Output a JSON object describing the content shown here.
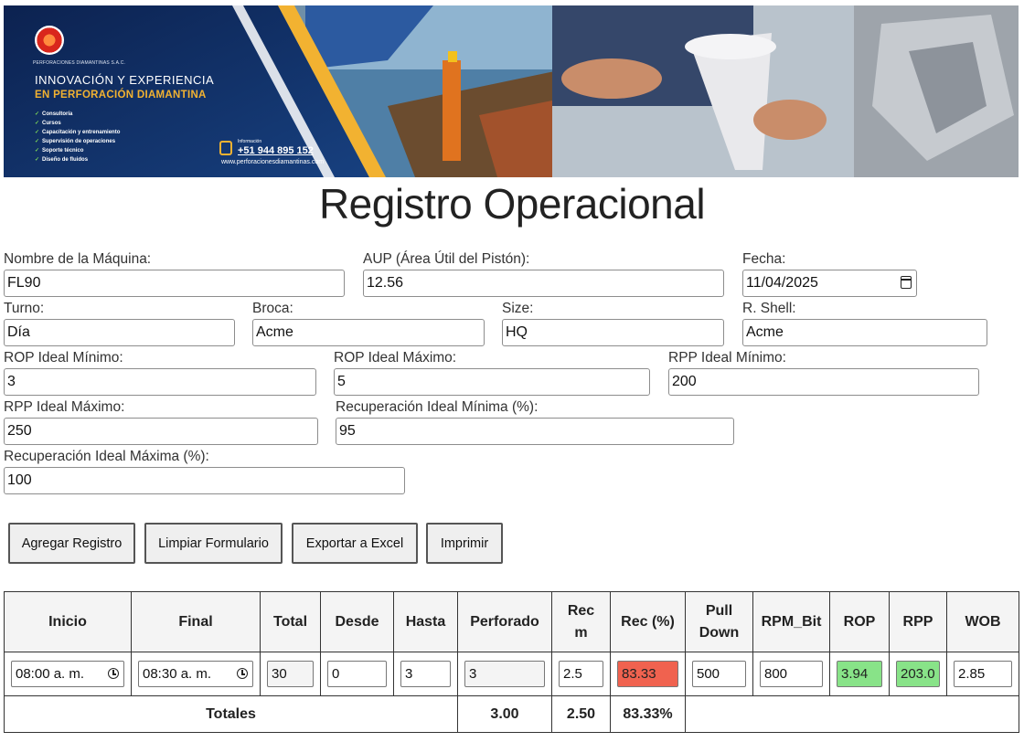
{
  "banner": {
    "company": "PERFORACIONES DIAMANTINAS S.A.C.",
    "headline1": "INNOVACIÓN Y EXPERIENCIA",
    "headline2": "EN PERFORACIÓN DIAMANTINA",
    "services": [
      "Consultoría",
      "Cursos",
      "Capacitación y entrenamiento",
      "Supervisión de operaciones",
      "Soporte técnico",
      "Diseño de fluidos"
    ],
    "info_label": "Información",
    "phone": "+51 944 895 152",
    "website": "www.perforacionesdiamantinas.com"
  },
  "title": "Registro Operacional",
  "form": {
    "maquina": {
      "label": "Nombre de la Máquina:",
      "value": "FL90"
    },
    "aup": {
      "label": "AUP (Área Útil del Pistón):",
      "value": "12.56"
    },
    "fecha": {
      "label": "Fecha:",
      "value": "11/04/2025"
    },
    "turno": {
      "label": "Turno:",
      "value": "Día"
    },
    "broca": {
      "label": "Broca:",
      "value": "Acme"
    },
    "size": {
      "label": "Size:",
      "value": "HQ"
    },
    "rshell": {
      "label": "R. Shell:",
      "value": "Acme"
    },
    "rop_min": {
      "label": "ROP Ideal Mínimo:",
      "value": "3"
    },
    "rop_max": {
      "label": "ROP Ideal Máximo:",
      "value": "5"
    },
    "rpp_min": {
      "label": "RPP Ideal Mínimo:",
      "value": "200"
    },
    "rpp_max": {
      "label": "RPP Ideal Máximo:",
      "value": "250"
    },
    "rec_min": {
      "label": "Recuperación Ideal Mínima (%):",
      "value": "95"
    },
    "rec_max": {
      "label": "Recuperación Ideal Máxima (%):",
      "value": "100"
    }
  },
  "buttons": {
    "agregar": "Agregar Registro",
    "limpiar": "Limpiar Formulario",
    "exportar": "Exportar a Excel",
    "imprimir": "Imprimir"
  },
  "table": {
    "headers": {
      "inicio": "Inicio",
      "final": "Final",
      "total": "Total",
      "desde": "Desde",
      "hasta": "Hasta",
      "perforado": "Perforado",
      "rec_m_1": "Rec",
      "rec_m_2": "m",
      "rec_pct": "Rec (%)",
      "pull_1": "Pull",
      "pull_2": "Down",
      "rpm_bit": "RPM_Bit",
      "rop": "ROP",
      "rpp": "RPP",
      "wob": "WOB"
    },
    "row": {
      "inicio": "08:00 a. m.",
      "final": "08:30 a. m.",
      "total": "30",
      "desde": "0",
      "hasta": "3",
      "perforado": "3",
      "rec_m": "2.5",
      "rec_pct": "83.33",
      "pull_down": "500",
      "rpm_bit": "800",
      "rop": "3.94",
      "rpp": "203.0",
      "wob": "2.85"
    },
    "totals": {
      "label": "Totales",
      "perforado": "3.00",
      "rec_m": "2.50",
      "rec_pct": "83.33%"
    }
  },
  "colors": {
    "bad": "#f0624f",
    "good": "#88e388",
    "banner_navy": "#0f2a5c",
    "accent_gold": "#f2b231"
  }
}
